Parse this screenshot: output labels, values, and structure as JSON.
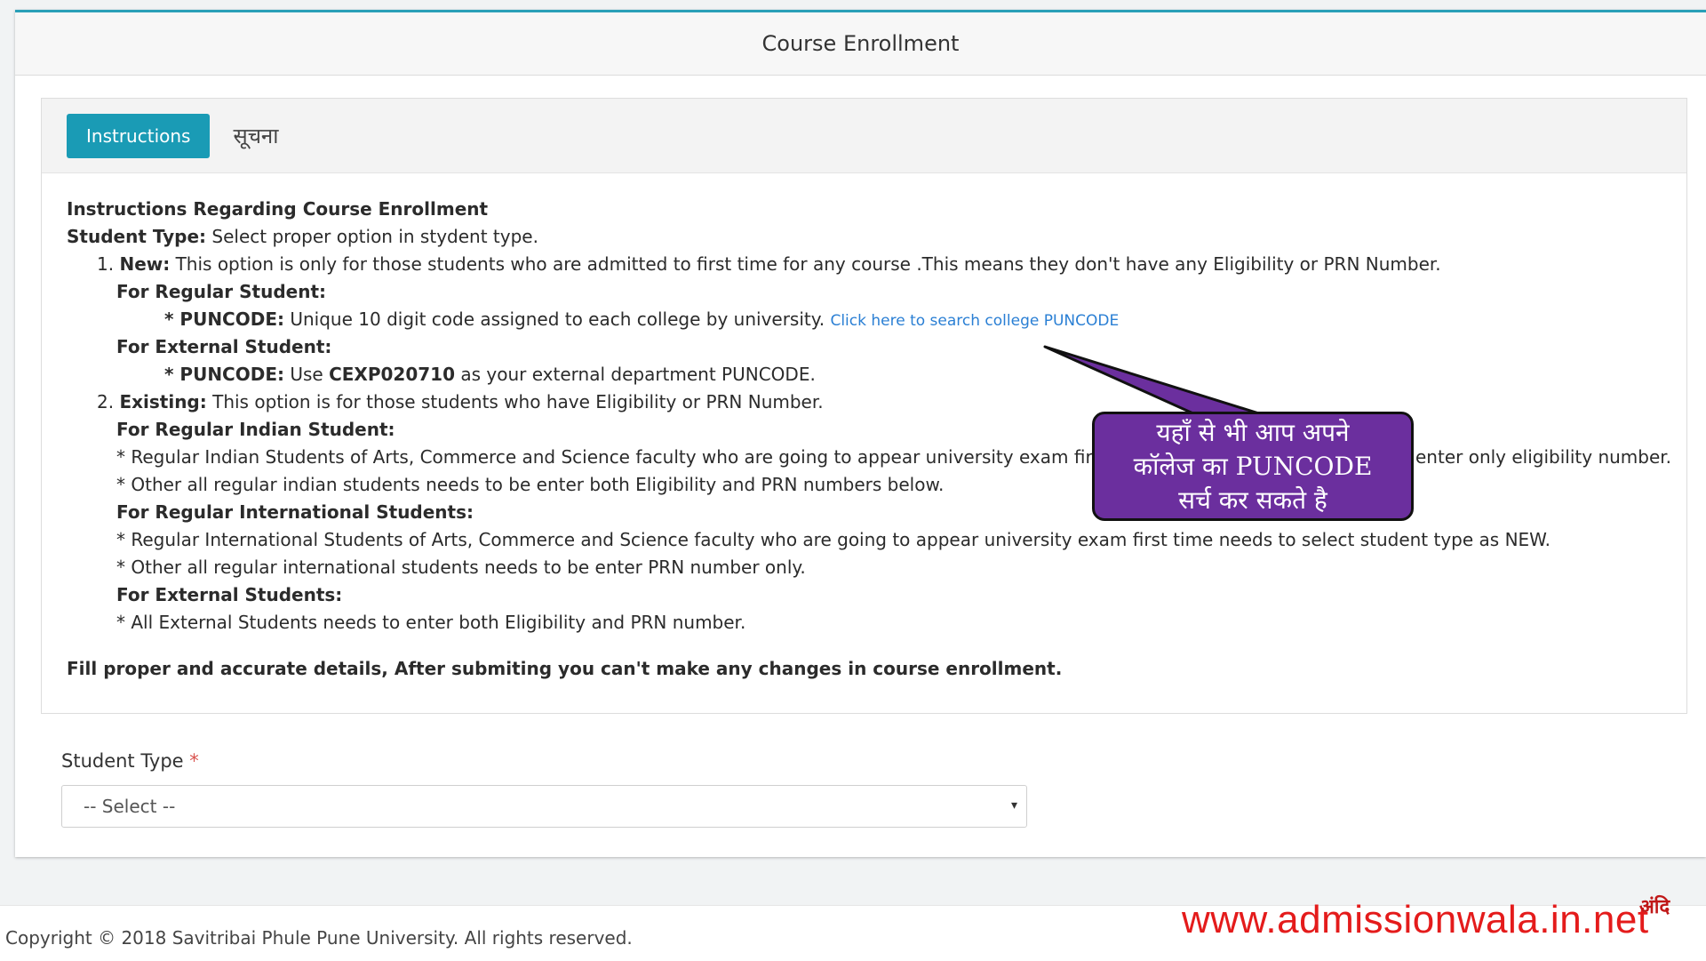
{
  "page": {
    "title": "Course Enrollment"
  },
  "tabs": [
    {
      "label": "Instructions",
      "active": true
    },
    {
      "label": "सूचना",
      "active": false
    }
  ],
  "instructions": {
    "heading": "Instructions Regarding Course Enrollment",
    "student_type_label": "Student Type:",
    "student_type_text": " Select proper option in stydent type.",
    "new_num": "1.",
    "new_label": "New:",
    "new_text": " This option is only for those students who are admitted to first time for any course .This means they don't have any Eligibility or PRN Number.",
    "for_regular_student": "For Regular Student:",
    "puncode_star": "* ",
    "puncode_label": "PUNCODE:",
    "puncode_regular_text": " Unique 10 digit code assigned to each college by university. ",
    "search_link": "Click here to search college PUNCODE",
    "for_external_student": "For External Student:",
    "puncode_external_pre": " Use ",
    "external_code": "CEXP020710",
    "puncode_external_post": " as your external department PUNCODE.",
    "existing_num": "2.",
    "existing_label": "Existing:",
    "existing_text": " This option is for those students who have Eligibility or PRN Number.",
    "for_regular_indian": "For Regular Indian Student:",
    "indian_line1_a": "* Regular Indian Students of Arts, Commerce and Science faculty who are going to appear university exam fir",
    "indian_line1_b": "enter only eligibility number.",
    "indian_line2": "* Other all regular indian students needs to be enter both Eligibility and PRN numbers below.",
    "for_regular_international": "For Regular International Students:",
    "intl_line1": "* Regular International Students of Arts, Commerce and Science faculty who are going to appear university exam first time needs to select student type as NEW.",
    "intl_line2": "* Other all regular international students needs to be enter PRN number only.",
    "for_external_students": "For External Students:",
    "ext_line1": "* All External Students needs to enter both Eligibility and PRN number.",
    "final_note": "Fill proper and accurate details, After submiting you can't make any changes in course enrollment."
  },
  "form": {
    "student_type_label": "Student Type",
    "required_mark": "*",
    "select_value": "-- Select --",
    "caret": "▾"
  },
  "callout": {
    "line1": "यहाँ से भी आप अपने",
    "line2": "कॉलेज का PUNCODE",
    "line3": "सर्च कर सकते है",
    "fill_color": "#6b2f9e"
  },
  "footer": {
    "copyright": "Copyright © 2018 Savitribai Phule Pune University. All rights reserved."
  },
  "watermark": {
    "text": "www.admissionwala.in.net",
    "logo": "अंदि"
  },
  "colors": {
    "accent": "#1a9bb5",
    "link": "#2a7fd4",
    "required": "#d9534f",
    "watermark": "#e41b1b"
  }
}
